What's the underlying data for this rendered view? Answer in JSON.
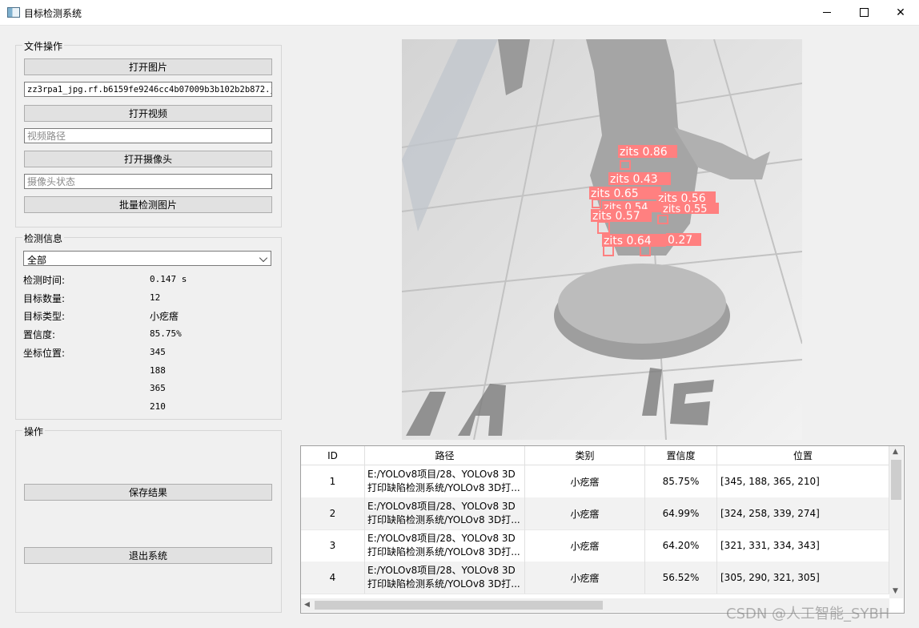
{
  "window": {
    "title": "目标检测系统"
  },
  "file_ops": {
    "group_title": "文件操作",
    "open_image_label": "打开图片",
    "image_path_value": "zz3rpa1_jpg.rf.b6159fe9246cc4b07009b3b102b2b872.jpg",
    "open_video_label": "打开视频",
    "video_path_placeholder": "视频路径",
    "open_camera_label": "打开摄像头",
    "camera_status_placeholder": "摄像头状态",
    "batch_detect_label": "批量检测图片"
  },
  "detect_info": {
    "group_title": "检测信息",
    "filter_selected": "全部",
    "time_label": "检测时间:",
    "time_value": "0.147 s",
    "count_label": "目标数量:",
    "count_value": "12",
    "type_label": "目标类型:",
    "type_value": "小疙瘩",
    "conf_label": "置信度:",
    "conf_value": "85.75%",
    "coord_label": "坐标位置:",
    "coords": [
      "345",
      "188",
      "365",
      "210"
    ]
  },
  "operations": {
    "group_title": "操作",
    "save_label": "保存结果",
    "exit_label": "退出系统"
  },
  "detections": [
    {
      "label": "zits",
      "score": "0.86"
    },
    {
      "label": "zits",
      "score": "0.43"
    },
    {
      "label": "zits",
      "score": "0.65"
    },
    {
      "label": "zits",
      "score": "0.56"
    },
    {
      "label": "zits",
      "score": "0.54"
    },
    {
      "label": "zits",
      "score": "0.55"
    },
    {
      "label": "zits",
      "score": "0.57"
    },
    {
      "label": "zits",
      "score": "0.64"
    },
    {
      "label": "zits",
      "score": "0.27"
    }
  ],
  "table": {
    "headers": [
      "ID",
      "路径",
      "类别",
      "置信度",
      "位置"
    ],
    "rows": [
      {
        "id": "1",
        "path": "E:/YOLOv8项目/28、YOLOv8 3D\n打印缺陷检测系统/YOLOv8 3D打...",
        "cls": "小疙瘩",
        "conf": "85.75%",
        "pos": "[345, 188, 365, 210]"
      },
      {
        "id": "2",
        "path": "E:/YOLOv8项目/28、YOLOv8 3D\n打印缺陷检测系统/YOLOv8 3D打...",
        "cls": "小疙瘩",
        "conf": "64.99%",
        "pos": "[324, 258, 339, 274]"
      },
      {
        "id": "3",
        "path": "E:/YOLOv8项目/28、YOLOv8 3D\n打印缺陷检测系统/YOLOv8 3D打...",
        "cls": "小疙瘩",
        "conf": "64.20%",
        "pos": "[321, 331, 334, 343]"
      },
      {
        "id": "4",
        "path": "E:/YOLOv8项目/28、YOLOv8 3D\n打印缺陷检测系统/YOLOv8 3D打...",
        "cls": "小疙瘩",
        "conf": "56.52%",
        "pos": "[305, 290, 321, 305]"
      }
    ]
  },
  "watermark": "CSDN @人工智能_SYBH",
  "colors": {
    "detection_box": "#ff8080",
    "window_bg": "#f0f0f0"
  }
}
